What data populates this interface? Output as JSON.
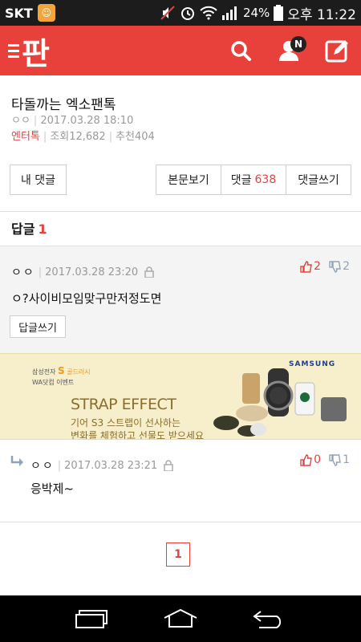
{
  "status_bar": {
    "carrier": "SKT",
    "battery": "24%",
    "time": "오후 11:22"
  },
  "app_bar": {
    "logo_text": "판",
    "notification_badge": "N",
    "accent_color": "#e8413c"
  },
  "post": {
    "title": "타돌까는 엑소팬톡",
    "author": "ㅇㅇ",
    "date": "2017.03.28 18:10",
    "category": "엔터톡",
    "views_label": "조회",
    "views": "12,682",
    "recommend_label": "추천",
    "recommend": "404"
  },
  "buttons": {
    "my_comments": "내 댓글",
    "view_body": "본문보기",
    "comments_label": "댓글",
    "comments_count": "638",
    "write_comment": "댓글쓰기"
  },
  "replies_header": {
    "label": "답글",
    "count": "1"
  },
  "comments": [
    {
      "author": "ㅇㅇ",
      "date": "2017.03.28 23:20",
      "text": "ㅇ?사이비모임맞구만저정도면",
      "up": "2",
      "down": "2",
      "reply_button": "답글쓰기"
    },
    {
      "author": "ㅇㅇ",
      "date": "2017.03.28 23:21",
      "text": "응박제~",
      "up": "0",
      "down": "1"
    }
  ],
  "ad": {
    "brand_small": "삼성전자",
    "brand_s": "S",
    "brand_suffix": "골드러시",
    "event": "WA닷컴 이벤트",
    "samsung": "SAMSUNG",
    "headline": "STRAP EFFECT",
    "line1": "기어 S3 스트랩이 선사하는",
    "line2": "변화를 체험하고 선물도 받으세요"
  },
  "pagination": {
    "current": "1"
  }
}
